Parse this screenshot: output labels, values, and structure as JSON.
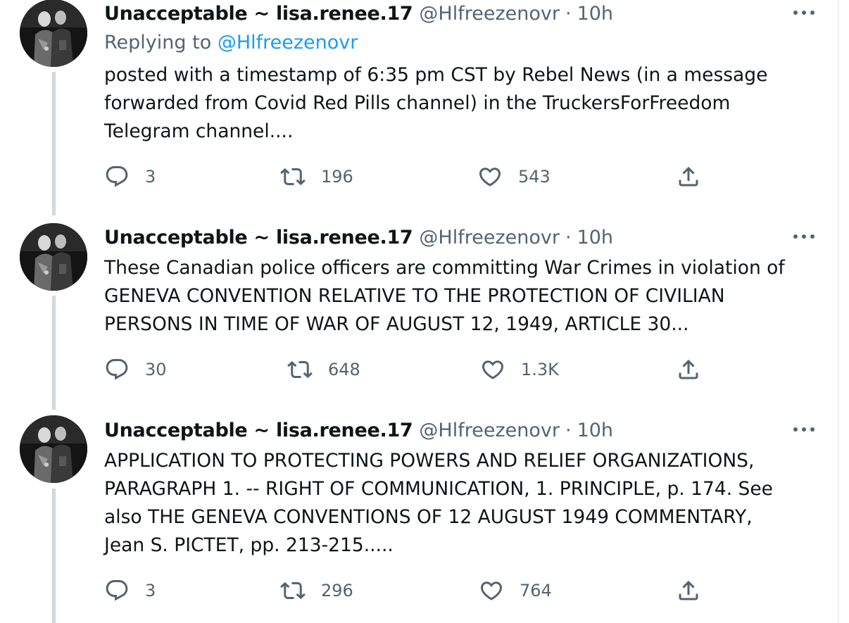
{
  "tweets": [
    {
      "name": "Unacceptable ~ lisa.renee.17",
      "handle": "@Hlfreezenovr",
      "separator": "·",
      "time": "10h",
      "replying_label": "Replying to",
      "replying_handle": "@Hlfreezenovr",
      "text": "posted with a timestamp of 6:35 pm CST by Rebel News (in a message\nforwarded from Covid Red Pills channel) in the TruckersForFreedom\nTelegram channel....",
      "replies": "3",
      "retweets": "196",
      "likes": "543"
    },
    {
      "name": "Unacceptable ~ lisa.renee.17",
      "handle": "@Hlfreezenovr",
      "separator": "·",
      "time": "10h",
      "text": "These Canadian police officers are committing War Crimes in violation of\nGENEVA CONVENTION RELATIVE TO THE PROTECTION OF CIVILIAN\nPERSONS IN TIME OF WAR OF AUGUST 12, 1949, ARTICLE 30...",
      "replies": "30",
      "retweets": "648",
      "likes": "1.3K"
    },
    {
      "name": "Unacceptable ~ lisa.renee.17",
      "handle": "@Hlfreezenovr",
      "separator": "·",
      "time": "10h",
      "text": "APPLICATION TO PROTECTING POWERS AND RELIEF ORGANIZATIONS,\nPARAGRAPH 1. -- RIGHT OF COMMUNICATION, 1. PRINCIPLE, p. 174. See\nalso THE GENEVA CONVENTIONS OF 12 AUGUST 1949 COMMENTARY,\nJean S. PICTET, pp. 213-215.....",
      "replies": "3",
      "retweets": "296",
      "likes": "764"
    }
  ],
  "icons": {
    "reply": "reply-icon",
    "retweet": "retweet-icon",
    "like": "heart-icon",
    "share": "share-icon",
    "more": "more-icon"
  },
  "colors": {
    "text": "#0f1419",
    "secondary": "#536471",
    "link": "#1d9bf0",
    "thread_line": "#cfd9de"
  }
}
